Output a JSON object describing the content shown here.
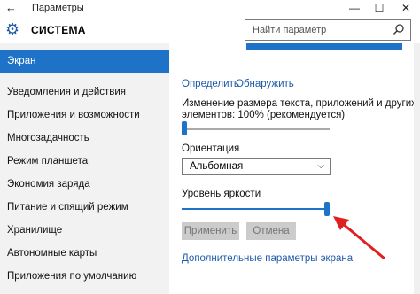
{
  "window": {
    "title": "Параметры",
    "back_icon": "arrow-left-icon",
    "minimize": "—",
    "maximize": "☐",
    "close": "✕"
  },
  "header": {
    "section_icon": "gear-icon",
    "section_title": "СИСТЕМА",
    "search_placeholder": "Найти параметр",
    "search_icon": "search-icon"
  },
  "sidebar": {
    "items": [
      {
        "label": "Экран",
        "active": true
      },
      {
        "label": "Уведомления и действия",
        "active": false
      },
      {
        "label": "Приложения и возможности",
        "active": false
      },
      {
        "label": "Многозадачность",
        "active": false
      },
      {
        "label": "Режим планшета",
        "active": false
      },
      {
        "label": "Экономия заряда",
        "active": false
      },
      {
        "label": "Питание и спящий режим",
        "active": false
      },
      {
        "label": "Хранилище",
        "active": false
      },
      {
        "label": "Автономные карты",
        "active": false
      },
      {
        "label": "Приложения по умолчанию",
        "active": false
      }
    ]
  },
  "main": {
    "identify_link": "Определить",
    "detect_link": "Обнаружить",
    "scale_label_line1": "Изменение размера текста, приложений и других",
    "scale_label_line2": "элементов: 100% (рекомендуется)",
    "scale_value_percent": 0,
    "orientation_label": "Ориентация",
    "orientation_value": "Альбомная",
    "brightness_label": "Уровень яркости",
    "brightness_value_percent": 100,
    "apply_button": "Применить",
    "cancel_button": "Отмена",
    "advanced_link": "Дополнительные параметры экрана"
  },
  "colors": {
    "accent": "#1e73c8",
    "annotation_arrow": "#e02020"
  }
}
